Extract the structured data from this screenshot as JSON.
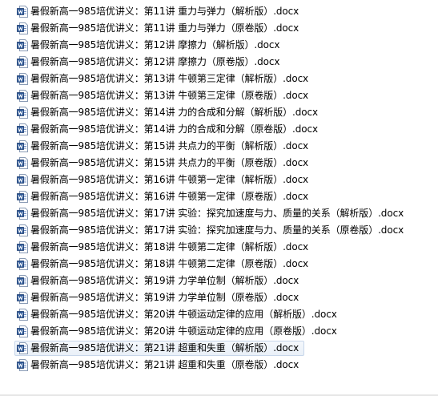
{
  "files": [
    {
      "name": "暑假新高一985培优讲义：第11讲 重力与弹力（解析版）.docx",
      "icon": "word-doc-icon"
    },
    {
      "name": "暑假新高一985培优讲义：第11讲 重力与弹力（原卷版）.docx",
      "icon": "word-doc-icon"
    },
    {
      "name": "暑假新高一985培优讲义：第12讲 摩擦力（解析版）.docx",
      "icon": "word-doc-icon"
    },
    {
      "name": "暑假新高一985培优讲义：第12讲 摩擦力（原卷版）.docx",
      "icon": "word-doc-icon"
    },
    {
      "name": "暑假新高一985培优讲义：第13讲 牛顿第三定律（解析版）.docx",
      "icon": "word-doc-icon"
    },
    {
      "name": "暑假新高一985培优讲义：第13讲 牛顿第三定律（原卷版）.docx",
      "icon": "word-doc-icon"
    },
    {
      "name": "暑假新高一985培优讲义：第14讲 力的合成和分解（解析版）.docx",
      "icon": "word-doc-icon"
    },
    {
      "name": "暑假新高一985培优讲义：第14讲 力的合成和分解（原卷版）.docx",
      "icon": "word-doc-icon"
    },
    {
      "name": "暑假新高一985培优讲义：第15讲 共点力的平衡（解析版）.docx",
      "icon": "word-doc-icon"
    },
    {
      "name": "暑假新高一985培优讲义：第15讲 共点力的平衡（原卷版）.docx",
      "icon": "word-doc-icon"
    },
    {
      "name": "暑假新高一985培优讲义：第16讲 牛顿第一定律（解析版）.docx",
      "icon": "word-doc-icon"
    },
    {
      "name": "暑假新高一985培优讲义：第16讲 牛顿第一定律（原卷版）.docx",
      "icon": "word-doc-icon"
    },
    {
      "name": "暑假新高一985培优讲义：第17讲 实验：探究加速度与力、质量的关系（解析版）.docx",
      "icon": "word-doc-icon"
    },
    {
      "name": "暑假新高一985培优讲义：第17讲 实验：探究加速度与力、质量的关系（原卷版）.docx",
      "icon": "word-doc-icon"
    },
    {
      "name": "暑假新高一985培优讲义：第18讲 牛顿第二定律（解析版）.docx",
      "icon": "word-doc-icon"
    },
    {
      "name": "暑假新高一985培优讲义：第18讲 牛顿第二定律（原卷版）.docx",
      "icon": "word-doc-icon"
    },
    {
      "name": "暑假新高一985培优讲义：第19讲 力学单位制（解析版）.docx",
      "icon": "word-doc-icon"
    },
    {
      "name": "暑假新高一985培优讲义：第19讲 力学单位制（原卷版）.docx",
      "icon": "word-doc-icon"
    },
    {
      "name": "暑假新高一985培优讲义：第20讲 牛顿运动定律的应用（解析版）.docx",
      "icon": "word-doc-icon"
    },
    {
      "name": "暑假新高一985培优讲义：第20讲 牛顿运动定律的应用（原卷版）.docx",
      "icon": "word-doc-icon"
    },
    {
      "name": "暑假新高一985培优讲义：第21讲 超重和失重（解析版）.docx",
      "icon": "word-doc-icon",
      "selected": true
    },
    {
      "name": "暑假新高一985培优讲义：第21讲 超重和失重（原卷版）.docx",
      "icon": "word-doc-icon"
    }
  ],
  "colors": {
    "icon_blue": "#2b5797",
    "icon_page": "#ffffff",
    "selection_border": "#c7d6ea",
    "text": "#000000"
  }
}
